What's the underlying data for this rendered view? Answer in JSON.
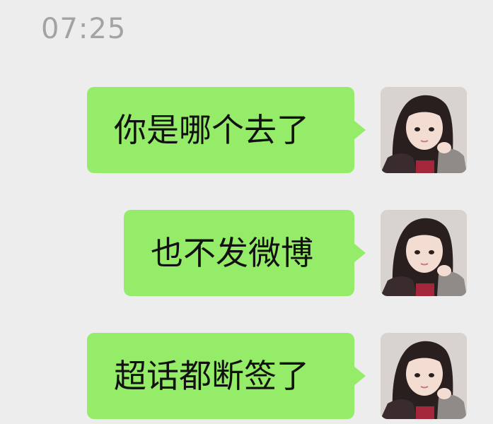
{
  "chat": {
    "timestamp": "07:25",
    "messages": [
      {
        "sender": "self",
        "text": "你是哪个去了",
        "avatar_icon": "user-avatar-icon"
      },
      {
        "sender": "self",
        "text": "也不发微博",
        "avatar_icon": "user-avatar-icon"
      },
      {
        "sender": "self",
        "text": "超话都断签了",
        "avatar_icon": "user-avatar-icon"
      }
    ]
  },
  "colors": {
    "background": "#ededed",
    "bubble": "#95ec69",
    "timestamp": "#a3a3a3",
    "text": "#111111"
  }
}
